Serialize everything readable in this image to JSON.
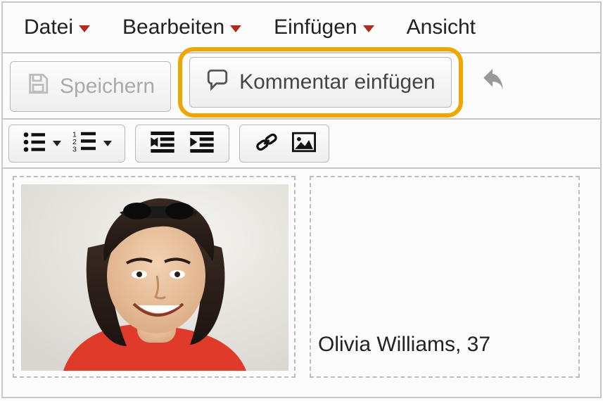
{
  "menu": {
    "file": "Datei",
    "edit": "Bearbeiten",
    "insert": "Einfügen",
    "view": "Ansicht"
  },
  "toolbar1": {
    "save": "Speichern",
    "comment": "Kommentar einfügen"
  },
  "content": {
    "person_label": "Olivia Williams, 37"
  },
  "icons": {
    "save": "save-icon",
    "comment": "speech-bubble-icon",
    "undo": "undo-icon",
    "ulist": "bulleted-list-icon",
    "olist": "numbered-list-icon",
    "outdent": "decrease-indent-icon",
    "indent": "increase-indent-icon",
    "link": "link-icon",
    "image": "image-icon"
  },
  "colors": {
    "highlight": "#f0a500",
    "menu_caret": "#b02a1f"
  }
}
